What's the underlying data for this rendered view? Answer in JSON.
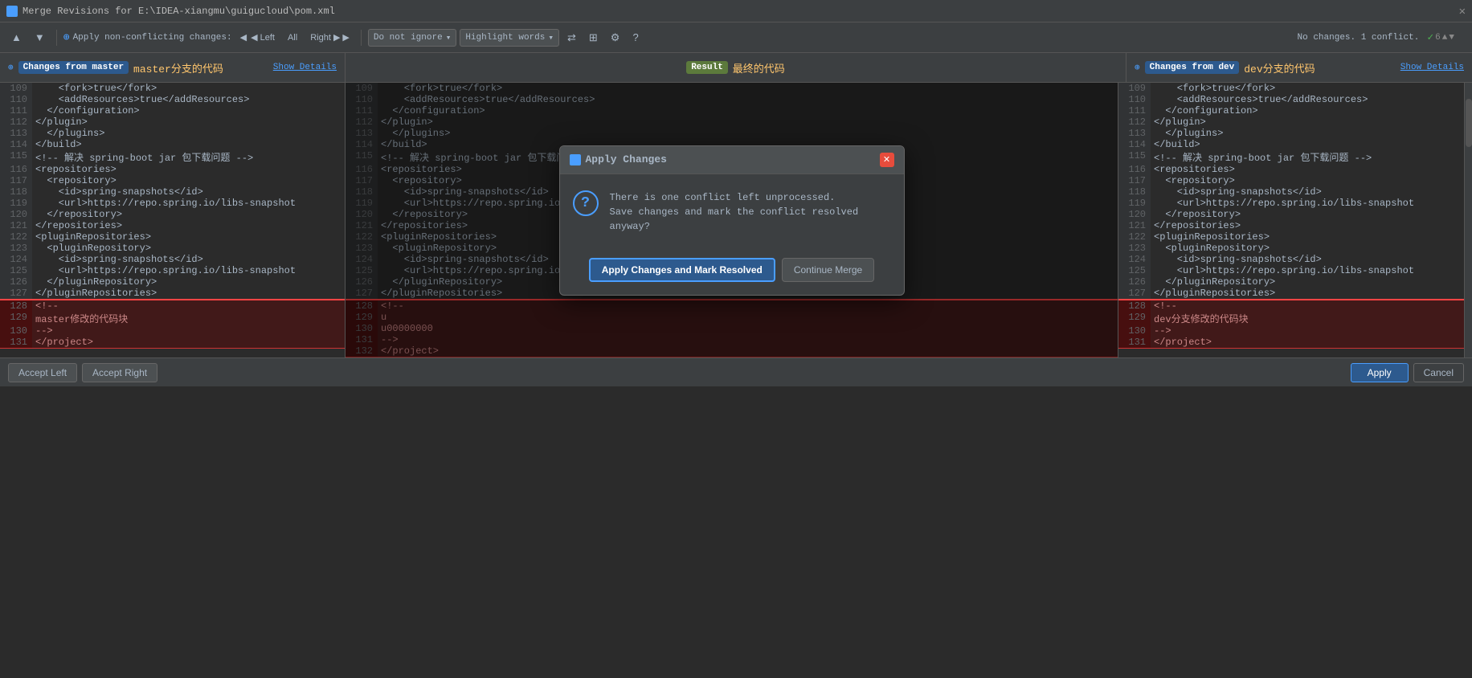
{
  "titleBar": {
    "title": "Merge Revisions for E:\\IDEA-xiangmu\\guigucloud\\pom.xml",
    "closeLabel": "✕"
  },
  "toolbar": {
    "arrowUpLabel": "▲",
    "arrowDownLabel": "▼",
    "applyNonConflictingLabel": "Apply non-conflicting changes:",
    "leftLabel": "◀ Left",
    "allLabel": "All",
    "rightLabel": "Right ▶",
    "doNotIgnoreLabel": "Do not ignore",
    "highlightWordsLabel": "Highlight words",
    "noChangesText": "No changes. 1 conflict.",
    "helpLabel": "?"
  },
  "panelHeaders": {
    "leftLabel": "Changes from master",
    "leftChinese": "master分支的代码",
    "leftShowDetails": "Show Details",
    "centerLabel": "Result",
    "centerChinese": "最终的代码",
    "rightLabel": "Changes from dev",
    "rightChinese": "dev分支的代码",
    "rightShowDetails": "Show Details"
  },
  "codeLines": [
    {
      "num": "109",
      "content": "    <fork>true</fork>"
    },
    {
      "num": "110",
      "content": "    <addResources>true</addResources>"
    },
    {
      "num": "111",
      "content": "  </configuration>"
    },
    {
      "num": "112",
      "content": "</plugin>"
    },
    {
      "num": "113",
      "content": "  </plugins>"
    },
    {
      "num": "114",
      "content": "</build>"
    },
    {
      "num": "115",
      "content": "<!-- 解决 spring-boot jar 包下载问题 -->"
    },
    {
      "num": "116",
      "content": "<repositories>"
    },
    {
      "num": "117",
      "content": "  <repository>"
    },
    {
      "num": "118",
      "content": "    <id>spring-snapshots</id>"
    },
    {
      "num": "119",
      "content": "    <url>https://repo.spring.io/libs-snapshot"
    },
    {
      "num": "120",
      "content": "  </repository>"
    },
    {
      "num": "121",
      "content": "</repositories>"
    },
    {
      "num": "122",
      "content": "<pluginRepositories>"
    },
    {
      "num": "123",
      "content": "  <pluginRepository>"
    },
    {
      "num": "124",
      "content": "    <id>spring-snapshots</id>"
    },
    {
      "num": "125",
      "content": "    <url>https://repo.spring.io/libs-snapshot"
    },
    {
      "num": "126",
      "content": "  </pluginRepository>"
    },
    {
      "num": "127",
      "content": "</pluginRepositories>"
    }
  ],
  "conflictLines": {
    "left": [
      {
        "num": "128",
        "content": "<!--"
      },
      {
        "num": "129",
        "content": "master修改的代码块"
      },
      {
        "num": "130",
        "content": "-->"
      },
      {
        "num": "131",
        "content": "</project>"
      }
    ],
    "center": [
      {
        "num": "128",
        "content": "<!--"
      },
      {
        "num": "129",
        "content": "u"
      },
      {
        "num": "130",
        "content": "u00000000"
      },
      {
        "num": "131",
        "content": "-->"
      },
      {
        "num": "132",
        "content": "</project>"
      }
    ],
    "right": [
      {
        "num": "128",
        "content": "<!--"
      },
      {
        "num": "129",
        "content": "dev分支修改的代码块"
      },
      {
        "num": "130",
        "content": "-->"
      },
      {
        "num": "131",
        "content": "</project>"
      }
    ]
  },
  "dialog": {
    "title": "Apply Changes",
    "closeLabel": "✕",
    "iconLabel": "?",
    "line1": "There is one conflict left unprocessed.",
    "line2": "Save changes and mark the conflict resolved anyway?",
    "primaryButtonLabel": "Apply Changes and Mark Resolved",
    "secondaryButtonLabel": "Continue Merge"
  },
  "bottomBar": {
    "acceptLeftLabel": "Accept Left",
    "acceptRightLabel": "Accept Right",
    "applyLabel": "Apply",
    "cancelLabel": "Cancel"
  },
  "annotations": {
    "leftChinese": "master分支的代码",
    "centerChinese": "最终的代码",
    "rightChinese": "dev分支的代码"
  }
}
